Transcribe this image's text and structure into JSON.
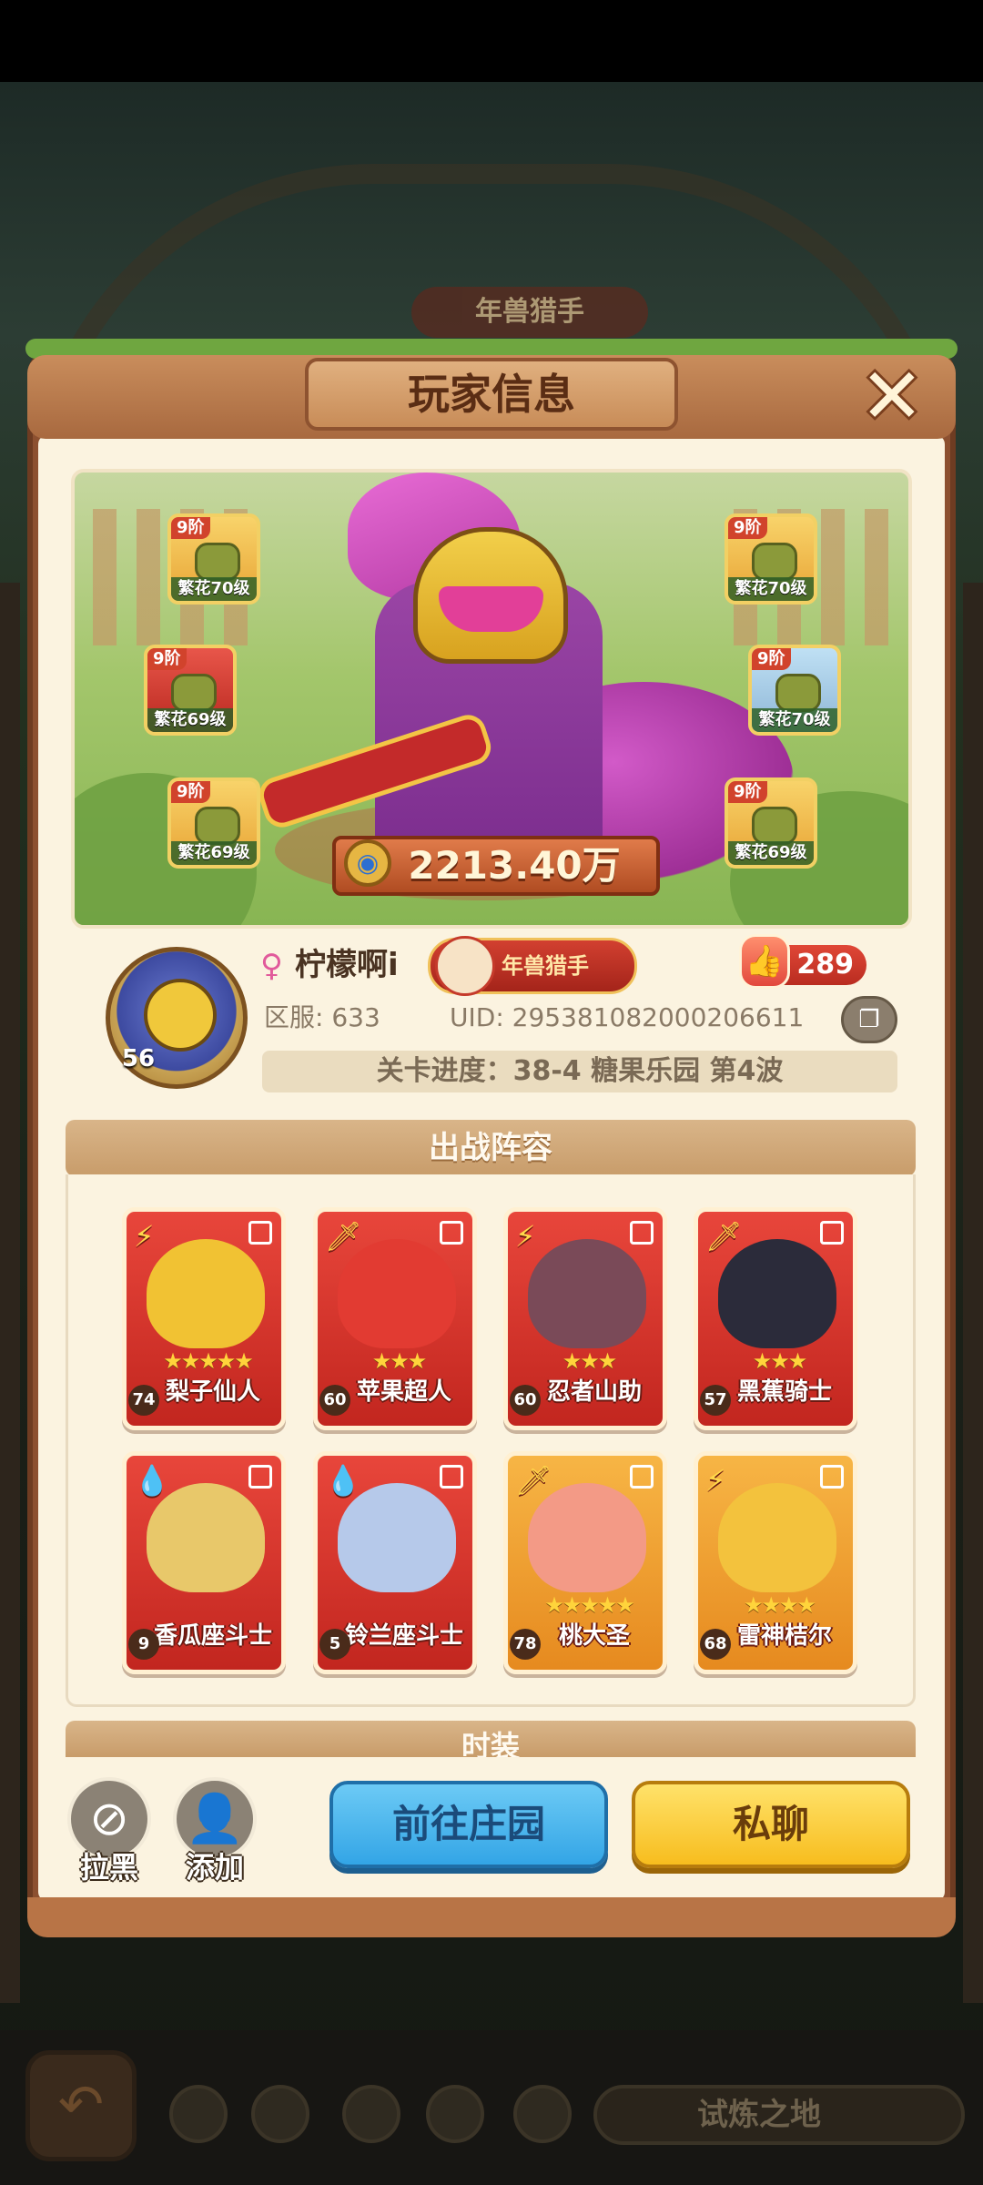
{
  "background": {
    "banner_title": "年兽猎手",
    "bottom_bar_label": "试炼之地"
  },
  "dialog": {
    "title": "玩家信息",
    "close_icon": "close-icon"
  },
  "hero": {
    "power": "2213.40万",
    "equipment": [
      {
        "tier": "9阶",
        "level": "繁花70级",
        "slot": "hat",
        "frame": "gold"
      },
      {
        "tier": "9阶",
        "level": "繁花69级",
        "slot": "weapon",
        "frame": "red"
      },
      {
        "tier": "9阶",
        "level": "繁花69级",
        "slot": "pants",
        "frame": "gold"
      },
      {
        "tier": "9阶",
        "level": "繁花70级",
        "slot": "armor",
        "frame": "gold"
      },
      {
        "tier": "9阶",
        "level": "繁花70级",
        "slot": "belt",
        "frame": "blue"
      },
      {
        "tier": "9阶",
        "level": "繁花69级",
        "slot": "boots",
        "frame": "gold"
      }
    ]
  },
  "profile": {
    "avatar_level": "56",
    "gender_icon": "female-icon",
    "name": "柠檬啊i",
    "title_badge": "年兽猎手",
    "likes": "289",
    "server": "区服: 633",
    "uid": "UID: 2953810820002066​11",
    "progress": "关卡进度：38-4  糖果乐园 第4波"
  },
  "lineup": {
    "header": "出战阵容",
    "cards": [
      {
        "name": "梨子仙人",
        "level": "74",
        "stars": "★★★★★",
        "color": "red",
        "element": "⚡",
        "char_color": "#f1c233"
      },
      {
        "name": "苹果超人",
        "level": "60",
        "stars": "★★★",
        "color": "red",
        "element": "🗡",
        "char_color": "#e23b32"
      },
      {
        "name": "忍者山助",
        "level": "60",
        "stars": "★★★",
        "color": "red",
        "element": "⚡",
        "char_color": "#7a4a58"
      },
      {
        "name": "黑蕉骑士",
        "level": "57",
        "stars": "★★★",
        "color": "red",
        "element": "🗡",
        "char_color": "#2b2b3a"
      },
      {
        "name": "香瓜座斗士",
        "level": "9",
        "stars": "",
        "color": "red",
        "element": "💧",
        "char_color": "#e8c86a"
      },
      {
        "name": "铃兰座斗士",
        "level": "5",
        "stars": "",
        "color": "red",
        "element": "💧",
        "char_color": "#b6c9ea"
      },
      {
        "name": "桃大圣",
        "level": "78",
        "stars": "★★★★★",
        "color": "orange",
        "element": "🗡",
        "char_color": "#f39a86"
      },
      {
        "name": "雷神桔尔",
        "level": "68",
        "stars": "★★★★",
        "color": "orange",
        "element": "⚡",
        "char_color": "#f3c23d"
      }
    ]
  },
  "next_section_header": "时装",
  "actions": {
    "block_label": "拉黑",
    "add_label": "添加",
    "visit_label": "前往庄园",
    "chat_label": "私聊"
  }
}
